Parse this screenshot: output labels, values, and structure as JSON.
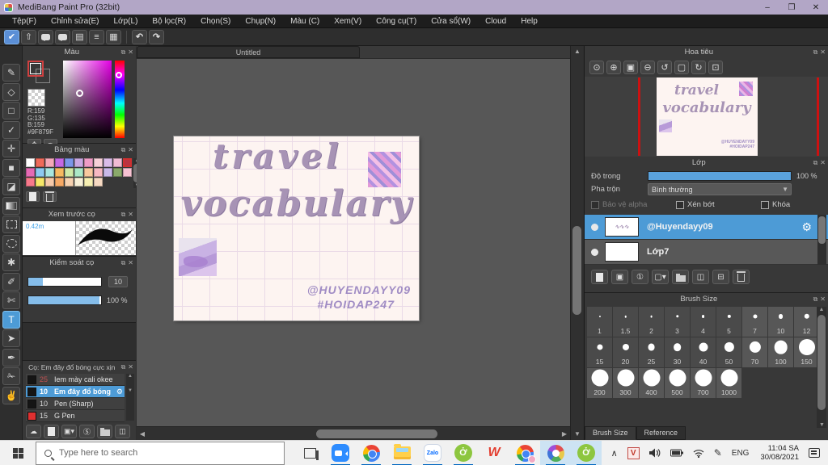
{
  "window": {
    "title": "MediBang Paint Pro (32bit)",
    "minimize": "–",
    "maximize": "❐",
    "close": "✕"
  },
  "menu": {
    "items": [
      "Tệp(F)",
      "Chỉnh sửa(E)",
      "Lớp(L)",
      "Bộ lọc(R)",
      "Chọn(S)",
      "Chụp(N)",
      "Màu (C)",
      "Xem(V)",
      "Công cụ(T)",
      "Cửa sổ(W)",
      "Cloud",
      "Help"
    ]
  },
  "toolbar": {
    "buttons": [
      {
        "name": "cloud-save-button",
        "glyph": "✔",
        "accent": true
      },
      {
        "name": "share-button",
        "glyph": "⇧"
      },
      {
        "name": "comment-button",
        "glyph": "bubble"
      },
      {
        "name": "message-button",
        "glyph": "bubble"
      },
      {
        "name": "document-button",
        "glyph": "▤"
      },
      {
        "name": "material-list-button",
        "glyph": "≡"
      },
      {
        "name": "grid-settings-button",
        "glyph": "▦"
      }
    ],
    "undo": "↶",
    "redo": "↷"
  },
  "tools": [
    {
      "name": "brush-tool",
      "glyph": "✎"
    },
    {
      "name": "eraser-tool",
      "glyph": "◇"
    },
    {
      "name": "shape-tool",
      "glyph": "□"
    },
    {
      "name": "polyline-tool",
      "glyph": "✓"
    },
    {
      "name": "move-tool",
      "glyph": "✛"
    },
    {
      "name": "fill-rect-tool",
      "glyph": "■"
    },
    {
      "name": "bucket-tool",
      "glyph": "◪"
    },
    {
      "name": "gradient-tool",
      "glyph": "gradient"
    },
    {
      "name": "select-rect-tool",
      "glyph": "selrect"
    },
    {
      "name": "lasso-tool",
      "glyph": "lasso"
    },
    {
      "name": "magic-wand-tool",
      "glyph": "✱"
    },
    {
      "name": "select-pen-tool",
      "glyph": "✐"
    },
    {
      "name": "select-eraser-tool",
      "glyph": "✄"
    },
    {
      "name": "text-tool",
      "glyph": "T",
      "active": true
    },
    {
      "name": "operation-tool",
      "glyph": "➤"
    },
    {
      "name": "eyedropper-tool",
      "glyph": "✒"
    },
    {
      "name": "divide-tool",
      "glyph": "✁"
    },
    {
      "name": "hand-tool",
      "glyph": "✌"
    }
  ],
  "color_panel": {
    "title": "Màu",
    "r_label": "R:159",
    "g_label": "G:135",
    "b_label": "B:159",
    "hex_label": "#9F879F",
    "fg_color": "#9F879F",
    "bg_color": "#F08878"
  },
  "palette_panel": {
    "title": "Bảng màu",
    "selected_index": 10,
    "swatches": [
      "#ffffff",
      "#ee6a5a",
      "#f4a9b8",
      "#c468e2",
      "#7b96e8",
      "#c9a8e2",
      "#ef9cc6",
      "#f7d1d8",
      "#d9bce9",
      "#f0bcd4",
      "#b93442",
      "#e56ab4",
      "#8ec9f0",
      "#a8e6e0",
      "#f6b961",
      "#cfe9a8",
      "#abe8c7",
      "#f7c99f",
      "#f6b8c2",
      "#c9b9e9",
      "#8aa96b",
      "#f7c2d2",
      "#f7798b",
      "#f6e668",
      "#f6c9a9",
      "#f6a965",
      "#f6d2b1",
      "#f7f0d9",
      "#f6efb2",
      "#f6d9c2"
    ]
  },
  "preview_panel": {
    "title": "Xem trước cọ",
    "size_label": "0.42m"
  },
  "control_panel": {
    "title": "Kiểm soát cọ",
    "slider1_value": "10",
    "slider1_pct": 20,
    "slider2_value": "100 %",
    "slider2_pct": 98
  },
  "brush_panel": {
    "title": "Cọ: Em đây đổ bóng cực xịn",
    "items": [
      {
        "size": "25",
        "name": "Iem mày cali okee",
        "swatch": "#151515",
        "num_color": "#c05050",
        "selected": false
      },
      {
        "size": "10",
        "name": "Em đây đổ bóng",
        "swatch": "#151515",
        "num_color": "#ffffff",
        "selected": true
      },
      {
        "size": "10",
        "name": "Pen (Sharp)",
        "swatch": "#151515",
        "num_color": "#d8d8d8",
        "selected": false
      },
      {
        "size": "15",
        "name": "G Pen",
        "swatch": "#e03030",
        "num_color": "#d8d8d8",
        "selected": false
      }
    ],
    "buttons": [
      {
        "name": "upload-brush-button",
        "glyph": "☁"
      },
      {
        "name": "add-brush-button",
        "glyph": "page"
      },
      {
        "name": "add-brush-image-button",
        "glyph": "▣▾"
      },
      {
        "name": "script-brush-button",
        "glyph": "Ⓢ"
      },
      {
        "name": "brush-folder-button",
        "glyph": "folder"
      },
      {
        "name": "duplicate-brush-button",
        "glyph": "◫"
      }
    ]
  },
  "palette_buttons": [
    {
      "name": "add-color-button",
      "glyph": "page"
    },
    {
      "name": "delete-color-button",
      "glyph": "trash"
    }
  ],
  "color_buttons": [
    {
      "name": "color-wheel-button",
      "glyph": "❖"
    },
    {
      "name": "color-pick-button",
      "glyph": "✒"
    }
  ],
  "canvas": {
    "tab": "Untitled",
    "art_line1": "travel",
    "art_line2": "vocabulary",
    "credit1": "@HUYENDAYY09",
    "credit2": "#HOIDAP247"
  },
  "navigator": {
    "title": "Hoa tiêu",
    "tools": [
      {
        "name": "zoom-100-button",
        "glyph": "⊙"
      },
      {
        "name": "zoom-in-button",
        "glyph": "⊕"
      },
      {
        "name": "fit-window-button",
        "glyph": "▣"
      },
      {
        "name": "zoom-out-button",
        "glyph": "⊖"
      },
      {
        "name": "rotate-left-button",
        "glyph": "↺"
      },
      {
        "name": "rotate-reset-button",
        "glyph": "▢"
      },
      {
        "name": "rotate-right-button",
        "glyph": "↻"
      },
      {
        "name": "lock-button",
        "glyph": "⊡"
      }
    ]
  },
  "layers_panel": {
    "title": "Lớp",
    "opacity_label": "Độ trong",
    "opacity_value": "100 %",
    "blend_label": "Pha trộn",
    "blend_value": "Bình thường",
    "check1": "Bảo vệ alpha",
    "check2": "Xén bớt",
    "check3": "Khóa",
    "layers": [
      {
        "name": "@Huyendayy09",
        "selected": true,
        "thumb": "text"
      },
      {
        "name": "Lớp7",
        "selected": false,
        "thumb": "checker"
      }
    ],
    "buttons": [
      {
        "name": "add-layer-button",
        "glyph": "page"
      },
      {
        "name": "copy-layer-button",
        "glyph": "▣"
      },
      {
        "name": "add-1bit-layer-button",
        "glyph": "①"
      },
      {
        "name": "add-special-layer-button",
        "glyph": "▢▾"
      },
      {
        "name": "layer-folder-button",
        "glyph": "folder"
      },
      {
        "name": "duplicate-layer-button",
        "glyph": "◫"
      },
      {
        "name": "merge-layer-button",
        "glyph": "⊟"
      },
      {
        "name": "delete-layer-button",
        "glyph": "trash"
      }
    ]
  },
  "brush_size_panel": {
    "title": "Brush Size",
    "sizes": [
      "1",
      "1.5",
      "2",
      "3",
      "4",
      "5",
      "7",
      "10",
      "12",
      "15",
      "20",
      "25",
      "30",
      "40",
      "50",
      "70",
      "100",
      "150",
      "200",
      "300",
      "400",
      "500",
      "700",
      "1000"
    ],
    "tabs": [
      {
        "label": "Brush Size",
        "active": true
      },
      {
        "label": "Reference",
        "active": false
      }
    ]
  },
  "taskbar": {
    "search_placeholder": "Type here to search",
    "apps": [
      {
        "name": "task-view",
        "icon": "taskview",
        "running": false
      },
      {
        "name": "zoom-app",
        "icon": "zoom",
        "running": true
      },
      {
        "name": "chrome",
        "icon": "chrome",
        "running": true
      },
      {
        "name": "file-explorer",
        "icon": "explorer",
        "running": true
      },
      {
        "name": "zalo",
        "icon": "zalo",
        "running": true,
        "label": "Zalo"
      },
      {
        "name": "coccoc",
        "icon": "coccoc",
        "running": true
      },
      {
        "name": "wps",
        "icon": "wps",
        "running": false,
        "label": "W"
      },
      {
        "name": "chrome-profile",
        "icon": "chrome-badge",
        "running": true
      },
      {
        "name": "medibang",
        "icon": "medibang",
        "running": true,
        "focus": true
      },
      {
        "name": "coccoc-2",
        "icon": "coccoc",
        "running": true,
        "focus": true
      }
    ],
    "tray": {
      "chevron": "∧",
      "ime": "V",
      "lang": "ENG",
      "time": "11:04 SA",
      "date": "30/08/2021"
    }
  }
}
